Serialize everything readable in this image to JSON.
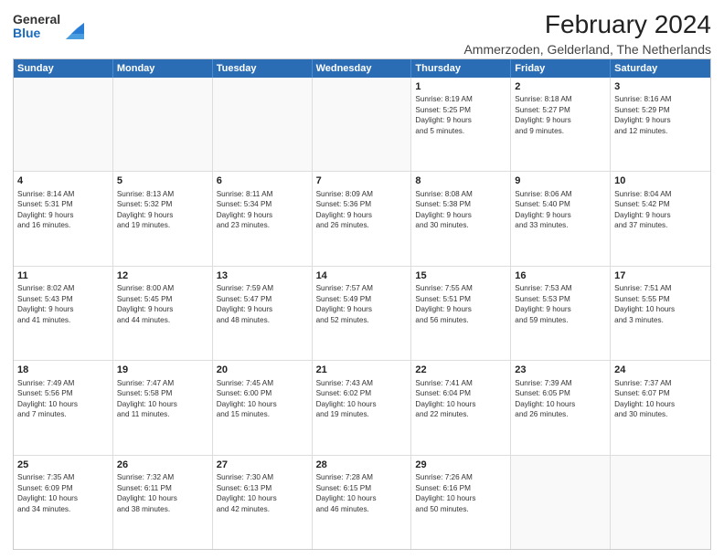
{
  "logo": {
    "general": "General",
    "blue": "Blue"
  },
  "header": {
    "title": "February 2024",
    "subtitle": "Ammerzoden, Gelderland, The Netherlands"
  },
  "calendar": {
    "days": [
      "Sunday",
      "Monday",
      "Tuesday",
      "Wednesday",
      "Thursday",
      "Friday",
      "Saturday"
    ],
    "rows": [
      [
        {
          "day": "",
          "content": ""
        },
        {
          "day": "",
          "content": ""
        },
        {
          "day": "",
          "content": ""
        },
        {
          "day": "",
          "content": ""
        },
        {
          "day": "1",
          "content": "Sunrise: 8:19 AM\nSunset: 5:25 PM\nDaylight: 9 hours\nand 5 minutes."
        },
        {
          "day": "2",
          "content": "Sunrise: 8:18 AM\nSunset: 5:27 PM\nDaylight: 9 hours\nand 9 minutes."
        },
        {
          "day": "3",
          "content": "Sunrise: 8:16 AM\nSunset: 5:29 PM\nDaylight: 9 hours\nand 12 minutes."
        }
      ],
      [
        {
          "day": "4",
          "content": "Sunrise: 8:14 AM\nSunset: 5:31 PM\nDaylight: 9 hours\nand 16 minutes."
        },
        {
          "day": "5",
          "content": "Sunrise: 8:13 AM\nSunset: 5:32 PM\nDaylight: 9 hours\nand 19 minutes."
        },
        {
          "day": "6",
          "content": "Sunrise: 8:11 AM\nSunset: 5:34 PM\nDaylight: 9 hours\nand 23 minutes."
        },
        {
          "day": "7",
          "content": "Sunrise: 8:09 AM\nSunset: 5:36 PM\nDaylight: 9 hours\nand 26 minutes."
        },
        {
          "day": "8",
          "content": "Sunrise: 8:08 AM\nSunset: 5:38 PM\nDaylight: 9 hours\nand 30 minutes."
        },
        {
          "day": "9",
          "content": "Sunrise: 8:06 AM\nSunset: 5:40 PM\nDaylight: 9 hours\nand 33 minutes."
        },
        {
          "day": "10",
          "content": "Sunrise: 8:04 AM\nSunset: 5:42 PM\nDaylight: 9 hours\nand 37 minutes."
        }
      ],
      [
        {
          "day": "11",
          "content": "Sunrise: 8:02 AM\nSunset: 5:43 PM\nDaylight: 9 hours\nand 41 minutes."
        },
        {
          "day": "12",
          "content": "Sunrise: 8:00 AM\nSunset: 5:45 PM\nDaylight: 9 hours\nand 44 minutes."
        },
        {
          "day": "13",
          "content": "Sunrise: 7:59 AM\nSunset: 5:47 PM\nDaylight: 9 hours\nand 48 minutes."
        },
        {
          "day": "14",
          "content": "Sunrise: 7:57 AM\nSunset: 5:49 PM\nDaylight: 9 hours\nand 52 minutes."
        },
        {
          "day": "15",
          "content": "Sunrise: 7:55 AM\nSunset: 5:51 PM\nDaylight: 9 hours\nand 56 minutes."
        },
        {
          "day": "16",
          "content": "Sunrise: 7:53 AM\nSunset: 5:53 PM\nDaylight: 9 hours\nand 59 minutes."
        },
        {
          "day": "17",
          "content": "Sunrise: 7:51 AM\nSunset: 5:55 PM\nDaylight: 10 hours\nand 3 minutes."
        }
      ],
      [
        {
          "day": "18",
          "content": "Sunrise: 7:49 AM\nSunset: 5:56 PM\nDaylight: 10 hours\nand 7 minutes."
        },
        {
          "day": "19",
          "content": "Sunrise: 7:47 AM\nSunset: 5:58 PM\nDaylight: 10 hours\nand 11 minutes."
        },
        {
          "day": "20",
          "content": "Sunrise: 7:45 AM\nSunset: 6:00 PM\nDaylight: 10 hours\nand 15 minutes."
        },
        {
          "day": "21",
          "content": "Sunrise: 7:43 AM\nSunset: 6:02 PM\nDaylight: 10 hours\nand 19 minutes."
        },
        {
          "day": "22",
          "content": "Sunrise: 7:41 AM\nSunset: 6:04 PM\nDaylight: 10 hours\nand 22 minutes."
        },
        {
          "day": "23",
          "content": "Sunrise: 7:39 AM\nSunset: 6:05 PM\nDaylight: 10 hours\nand 26 minutes."
        },
        {
          "day": "24",
          "content": "Sunrise: 7:37 AM\nSunset: 6:07 PM\nDaylight: 10 hours\nand 30 minutes."
        }
      ],
      [
        {
          "day": "25",
          "content": "Sunrise: 7:35 AM\nSunset: 6:09 PM\nDaylight: 10 hours\nand 34 minutes."
        },
        {
          "day": "26",
          "content": "Sunrise: 7:32 AM\nSunset: 6:11 PM\nDaylight: 10 hours\nand 38 minutes."
        },
        {
          "day": "27",
          "content": "Sunrise: 7:30 AM\nSunset: 6:13 PM\nDaylight: 10 hours\nand 42 minutes."
        },
        {
          "day": "28",
          "content": "Sunrise: 7:28 AM\nSunset: 6:15 PM\nDaylight: 10 hours\nand 46 minutes."
        },
        {
          "day": "29",
          "content": "Sunrise: 7:26 AM\nSunset: 6:16 PM\nDaylight: 10 hours\nand 50 minutes."
        },
        {
          "day": "",
          "content": ""
        },
        {
          "day": "",
          "content": ""
        }
      ]
    ]
  }
}
